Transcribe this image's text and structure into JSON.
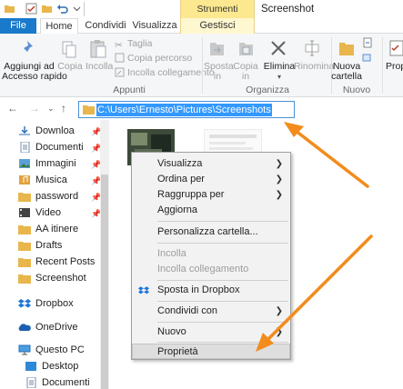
{
  "window": {
    "title": "Screenshot"
  },
  "tabs": {
    "file": "File",
    "home": "Home",
    "share": "Condividi",
    "view": "Visualizza",
    "context_header": "Strumenti immagini",
    "manage": "Gestisci"
  },
  "ribbon": {
    "pin_quick_access": "Aggiungi ad\nAccesso rapido",
    "copy": "Copia",
    "paste": "Incolla",
    "cut": "Taglia",
    "copy_path": "Copia percorso",
    "paste_shortcut": "Incolla collegamento",
    "move_to": "Sposta\nin",
    "copy_to": "Copia\nin",
    "delete": "Elimina",
    "rename": "Rinomina",
    "new_folder": "Nuova\ncartella",
    "properties": "Prop",
    "group_clipboard": "Appunti",
    "group_organize": "Organizza",
    "group_new": "Nuovo"
  },
  "address": {
    "path": "C:\\Users\\Ernesto\\Pictures\\Screenshots"
  },
  "nav": {
    "items": [
      {
        "label": "Downloa",
        "pinned": true
      },
      {
        "label": "Documenti",
        "pinned": true
      },
      {
        "label": "Immagini",
        "pinned": true
      },
      {
        "label": "Musica",
        "pinned": true
      },
      {
        "label": "password",
        "pinned": true
      },
      {
        "label": "Video",
        "pinned": true
      },
      {
        "label": "AA itinere",
        "pinned": false
      },
      {
        "label": "Drafts",
        "pinned": false
      },
      {
        "label": "Recent Posts",
        "pinned": false
      },
      {
        "label": "Screenshot",
        "pinned": false
      },
      {
        "label": "Dropbox",
        "pinned": false
      },
      {
        "label": "OneDrive",
        "pinned": false
      },
      {
        "label": "Questo PC",
        "pinned": false
      },
      {
        "label": "Desktop",
        "pinned": false
      },
      {
        "label": "Documenti",
        "pinned": false
      }
    ],
    "pin_glyph": "📌"
  },
  "context_menu": {
    "view": "Visualizza",
    "sort_by": "Ordina per",
    "group_by": "Raggruppa per",
    "refresh": "Aggiorna",
    "customize": "Personalizza cartella...",
    "paste": "Incolla",
    "paste_shortcut": "Incolla collegamento",
    "move_dropbox": "Sposta in Dropbox",
    "share_with": "Condividi con",
    "new": "Nuovo",
    "properties": "Proprietà",
    "arrow": "❯"
  },
  "colors": {
    "accent": "#1979ca",
    "annotation_arrow": "#f28c1c",
    "selection": "#3399ff",
    "context_tab": "#fce88f"
  }
}
